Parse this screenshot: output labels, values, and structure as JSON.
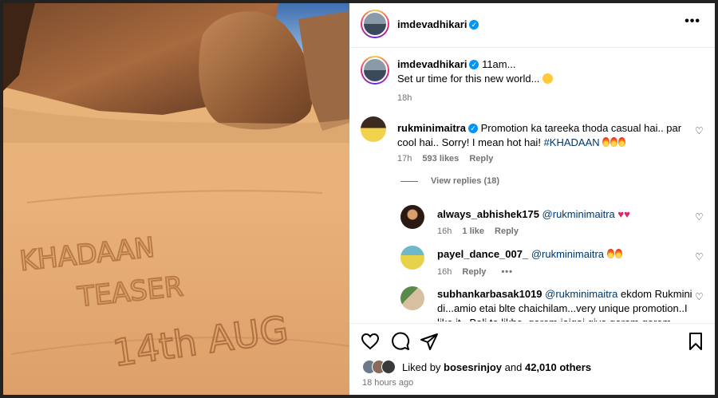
{
  "header": {
    "username": "imdevadhikari",
    "more_icon": "more-horizontal-icon"
  },
  "caption": {
    "username": "imdevadhikari",
    "time_line": "11am...",
    "body": "Set ur time for this new world...",
    "emoji": "slightly-smiling-face",
    "age": "18h"
  },
  "photo": {
    "sand_text": [
      "KHADAAN",
      "TEASER",
      "14th AUG"
    ]
  },
  "comments": [
    {
      "username": "rukminimaitra",
      "verified": true,
      "text": "Promotion ka tareeka thoda casual hai.. par cool hai.. Sorry! I mean hot hai!",
      "hashtag": "#KHADAAN",
      "emoji_count": 3,
      "age": "17h",
      "likes": "593 likes",
      "reply": "Reply",
      "view_replies": "View replies (18)"
    }
  ],
  "replies": [
    {
      "username": "always_abhishek175",
      "mention": "@rukminimaitra",
      "age": "16h",
      "likes": "1 like",
      "reply": "Reply"
    },
    {
      "username": "payel_dance_007_",
      "mention": "@rukminimaitra",
      "age": "16h",
      "reply": "Reply",
      "more": "•••"
    },
    {
      "username": "subhankarbasak1019",
      "mention": "@rukminimaitra",
      "text": " ekdom Rukmini di...amio etai blte chaichilam...very unique promotion..I like it.. Bali te likhe. gorom jaigai giye gorom gorom"
    }
  ],
  "footer": {
    "liked_by_prefix": "Liked by",
    "liked_by_user": "bosesrinjoy",
    "and": "and",
    "others": "42,010 others",
    "timestamp": "18 hours ago"
  },
  "colors": {
    "link": "#00376b",
    "meta": "#737373",
    "verified": "#0095f6"
  }
}
